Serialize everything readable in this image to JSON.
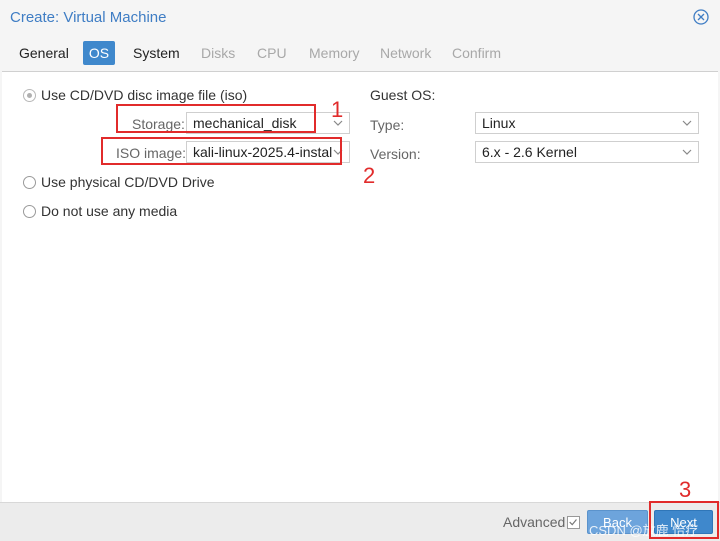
{
  "window": {
    "title": "Create: Virtual Machine",
    "close_icon": "close-circle-icon"
  },
  "tabs": [
    {
      "label": "General",
      "state": "normal"
    },
    {
      "label": "OS",
      "state": "active"
    },
    {
      "label": "System",
      "state": "normal"
    },
    {
      "label": "Disks",
      "state": "disabled"
    },
    {
      "label": "CPU",
      "state": "disabled"
    },
    {
      "label": "Memory",
      "state": "disabled"
    },
    {
      "label": "Network",
      "state": "disabled"
    },
    {
      "label": "Confirm",
      "state": "disabled"
    }
  ],
  "media": {
    "iso_option": "Use CD/DVD disc image file (iso)",
    "storage_label": "Storage:",
    "storage_value": "mechanical_disk",
    "iso_label": "ISO image:",
    "iso_value": "kali-linux-2025.4-instal",
    "physical_option": "Use physical CD/DVD Drive",
    "none_option": "Do not use any media"
  },
  "guest_os": {
    "heading": "Guest OS:",
    "type_label": "Type:",
    "type_value": "Linux",
    "version_label": "Version:",
    "version_value": "6.x - 2.6 Kernel"
  },
  "annotations": {
    "one": "1",
    "two": "2",
    "three": "3"
  },
  "footer": {
    "advanced_label": "Advanced",
    "advanced_checked": true,
    "back_label": "Back",
    "next_label": "Next",
    "watermark": "CSDN @放鹿 怡疗"
  },
  "colors": {
    "accent": "#3f88cc",
    "title": "#3f7dc4",
    "annotation": "#e12b2b"
  }
}
